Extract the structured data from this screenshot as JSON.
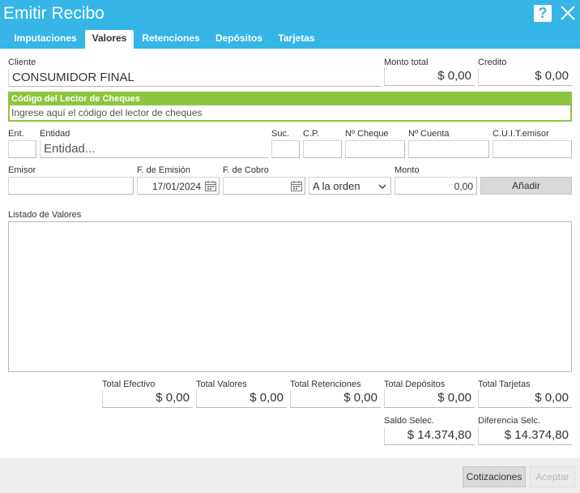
{
  "window": {
    "title": "Emitir Recibo",
    "help_glyph": "?"
  },
  "tabs": [
    {
      "label": "Imputaciones",
      "active": false
    },
    {
      "label": "Valores",
      "active": true
    },
    {
      "label": "Retenciones",
      "active": false
    },
    {
      "label": "Depósitos",
      "active": false
    },
    {
      "label": "Tarjetas",
      "active": false
    }
  ],
  "header": {
    "cliente_label": "Cliente",
    "cliente_value": "CONSUMIDOR FINAL",
    "monto_total_label": "Monto total",
    "monto_total_value": "$ 0,00",
    "credito_label": "Credito",
    "credito_value": "$ 0,00"
  },
  "cheque_reader": {
    "title": "Código del Lector de Cheques",
    "placeholder": "Ingrese aquí el código del lector de cheques"
  },
  "cheque_row1": {
    "ent_label": "Ent.",
    "entidad_label": "Entidad",
    "entidad_placeholder": "Entidad...",
    "suc_label": "Suc.",
    "cp_label": "C.P.",
    "nro_cheque_label": "Nº Cheque",
    "nro_cuenta_label": "Nº Cuenta",
    "cuit_label": "C.U.I.T.emisor"
  },
  "cheque_row2": {
    "emisor_label": "Emisor",
    "f_emision_label": "F. de Emisión",
    "f_emision_value": "17/01/2024",
    "f_cobro_label": "F. de Cobro",
    "orden_value": "A la orden",
    "monto_label": "Monto",
    "monto_value": "0,00",
    "add_button": "Añadir"
  },
  "listado": {
    "label": "Listado de Valores"
  },
  "totals": {
    "efectivo_label": "Total Efectivo",
    "efectivo_value": "$ 0,00",
    "valores_label": "Total Valores",
    "valores_value": "$ 0,00",
    "retenciones_label": "Total Retenciones",
    "retenciones_value": "$ 0,00",
    "depositos_label": "Total Depósitos",
    "depositos_value": "$ 0,00",
    "tarjetas_label": "Total Tarjetas",
    "tarjetas_value": "$ 0,00",
    "saldo_label": "Saldo Selec.",
    "saldo_value": "$ 14.374,80",
    "diferencia_label": "Diferencia Selc.",
    "diferencia_value": "$ 14.374,80"
  },
  "footer": {
    "cotizaciones_button": "Cotizaciones",
    "aceptar_button": "Aceptar"
  },
  "colors": {
    "titlebar": "#35b6e6",
    "reader_accent": "#8cc63f",
    "footer_bg": "#eeeeee"
  }
}
